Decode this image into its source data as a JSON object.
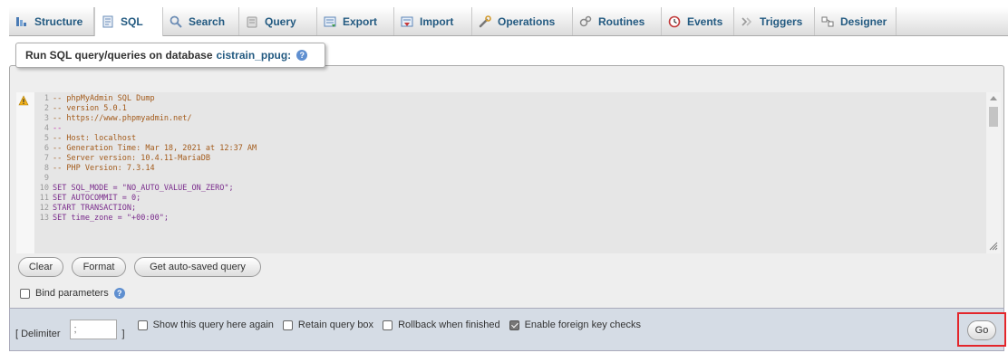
{
  "tabs": [
    {
      "label": "Structure",
      "icon": "structure-icon",
      "active": false
    },
    {
      "label": "SQL",
      "icon": "sql-icon",
      "active": true
    },
    {
      "label": "Search",
      "icon": "search-icon",
      "active": false
    },
    {
      "label": "Query",
      "icon": "query-icon",
      "active": false
    },
    {
      "label": "Export",
      "icon": "export-icon",
      "active": false
    },
    {
      "label": "Import",
      "icon": "import-icon",
      "active": false
    },
    {
      "label": "Operations",
      "icon": "wrench-icon",
      "active": false
    },
    {
      "label": "Routines",
      "icon": "routines-icon",
      "active": false
    },
    {
      "label": "Events",
      "icon": "clock-icon",
      "active": false
    },
    {
      "label": "Triggers",
      "icon": "triggers-icon",
      "active": false
    },
    {
      "label": "Designer",
      "icon": "designer-icon",
      "active": false
    }
  ],
  "legend": {
    "prefix": "Run SQL query/queries on database",
    "database": "cistrain_ppug:"
  },
  "editor": {
    "lines": [
      {
        "n": "1",
        "text": "-- phpMyAdmin SQL Dump"
      },
      {
        "n": "2",
        "text": "-- version 5.0.1"
      },
      {
        "n": "3",
        "text": "-- https://www.phpmyadmin.net/"
      },
      {
        "n": "4",
        "text": "--"
      },
      {
        "n": "5",
        "text": "-- Host: localhost"
      },
      {
        "n": "6",
        "text": "-- Generation Time: Mar 18, 2021 at 12:37 AM"
      },
      {
        "n": "7",
        "text": "-- Server version: 10.4.11-MariaDB"
      },
      {
        "n": "8",
        "text": "-- PHP Version: 7.3.14"
      },
      {
        "n": "9",
        "text": ""
      },
      {
        "n": "10",
        "text": "SET SQL_MODE = \"NO_AUTO_VALUE_ON_ZERO\";"
      },
      {
        "n": "11",
        "text": "SET AUTOCOMMIT = 0;"
      },
      {
        "n": "12",
        "text": "START TRANSACTION;"
      },
      {
        "n": "13",
        "text": "SET time_zone = \"+00:00\";"
      }
    ]
  },
  "buttons": {
    "clear": "Clear",
    "format": "Format",
    "autosaved": "Get auto-saved query",
    "go": "Go"
  },
  "bind_parameters": {
    "label": "Bind parameters",
    "checked": false
  },
  "bottom": {
    "delimiter_label": "[ Delimiter",
    "delimiter_value": ";",
    "delimiter_close": "]",
    "options": [
      {
        "label": "Show this query here again",
        "checked": false
      },
      {
        "label": "Retain query box",
        "checked": false
      },
      {
        "label": "Rollback when finished",
        "checked": false
      },
      {
        "label": "Enable foreign key checks",
        "checked": true
      }
    ]
  },
  "colors": {
    "link": "#235a81",
    "bottom_bar": "#d5dce5",
    "highlight_box": "#e3262b"
  }
}
